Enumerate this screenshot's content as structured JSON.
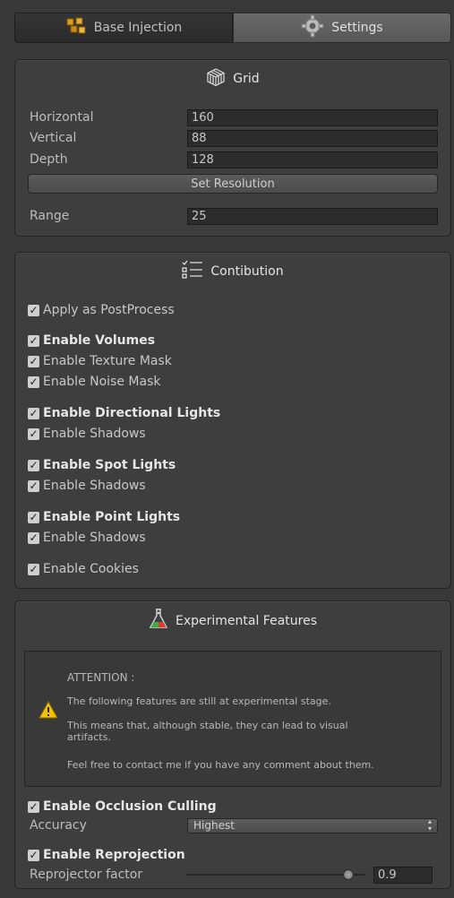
{
  "tabs": [
    {
      "label": "Base Injection",
      "icon": "cubes-icon",
      "active": false
    },
    {
      "label": "Settings",
      "icon": "gear-icon",
      "active": true
    }
  ],
  "grid": {
    "title": "Grid",
    "fields": [
      {
        "label": "Horizontal",
        "value": "160"
      },
      {
        "label": "Vertical",
        "value": "88"
      },
      {
        "label": "Depth",
        "value": "128"
      }
    ],
    "set_resolution_label": "Set Resolution",
    "range": {
      "label": "Range",
      "value": "25"
    }
  },
  "contribution": {
    "title": "Contibution",
    "items": [
      {
        "label": "Apply as PostProcess",
        "checked": true,
        "bold": false
      },
      {
        "label": "Enable Volumes",
        "checked": true,
        "bold": true
      },
      {
        "label": "Enable Texture Mask",
        "checked": true,
        "bold": false
      },
      {
        "label": "Enable Noise Mask",
        "checked": true,
        "bold": false
      },
      {
        "label": "Enable Directional Lights",
        "checked": true,
        "bold": true
      },
      {
        "label": "Enable Shadows",
        "checked": true,
        "bold": false
      },
      {
        "label": "Enable Spot Lights",
        "checked": true,
        "bold": true
      },
      {
        "label": "Enable Shadows",
        "checked": true,
        "bold": false
      },
      {
        "label": "Enable Point Lights",
        "checked": true,
        "bold": true
      },
      {
        "label": "Enable Shadows",
        "checked": true,
        "bold": false
      },
      {
        "label": "Enable Cookies",
        "checked": true,
        "bold": false
      }
    ]
  },
  "experimental": {
    "title": "Experimental Features",
    "notice": {
      "heading": "ATTENTION :",
      "line1": "The following features are still at experimental stage.",
      "line2": "This means that, although stable, they can lead to visual artifacts.",
      "line3": "Feel free to contact me if you have any comment about them."
    },
    "occlusion": {
      "label": "Enable Occlusion Culling",
      "checked": true
    },
    "accuracy": {
      "label": "Accuracy",
      "value": "Highest"
    },
    "reprojection": {
      "label": "Enable Reprojection",
      "checked": true
    },
    "reprojector": {
      "label": "Reprojector factor",
      "value": "0.9",
      "fraction": 0.9
    }
  },
  "colors": {
    "background": "#383838",
    "panel": "#3e3e3e",
    "field": "#2c2c2c",
    "warning": "#f2c200"
  }
}
